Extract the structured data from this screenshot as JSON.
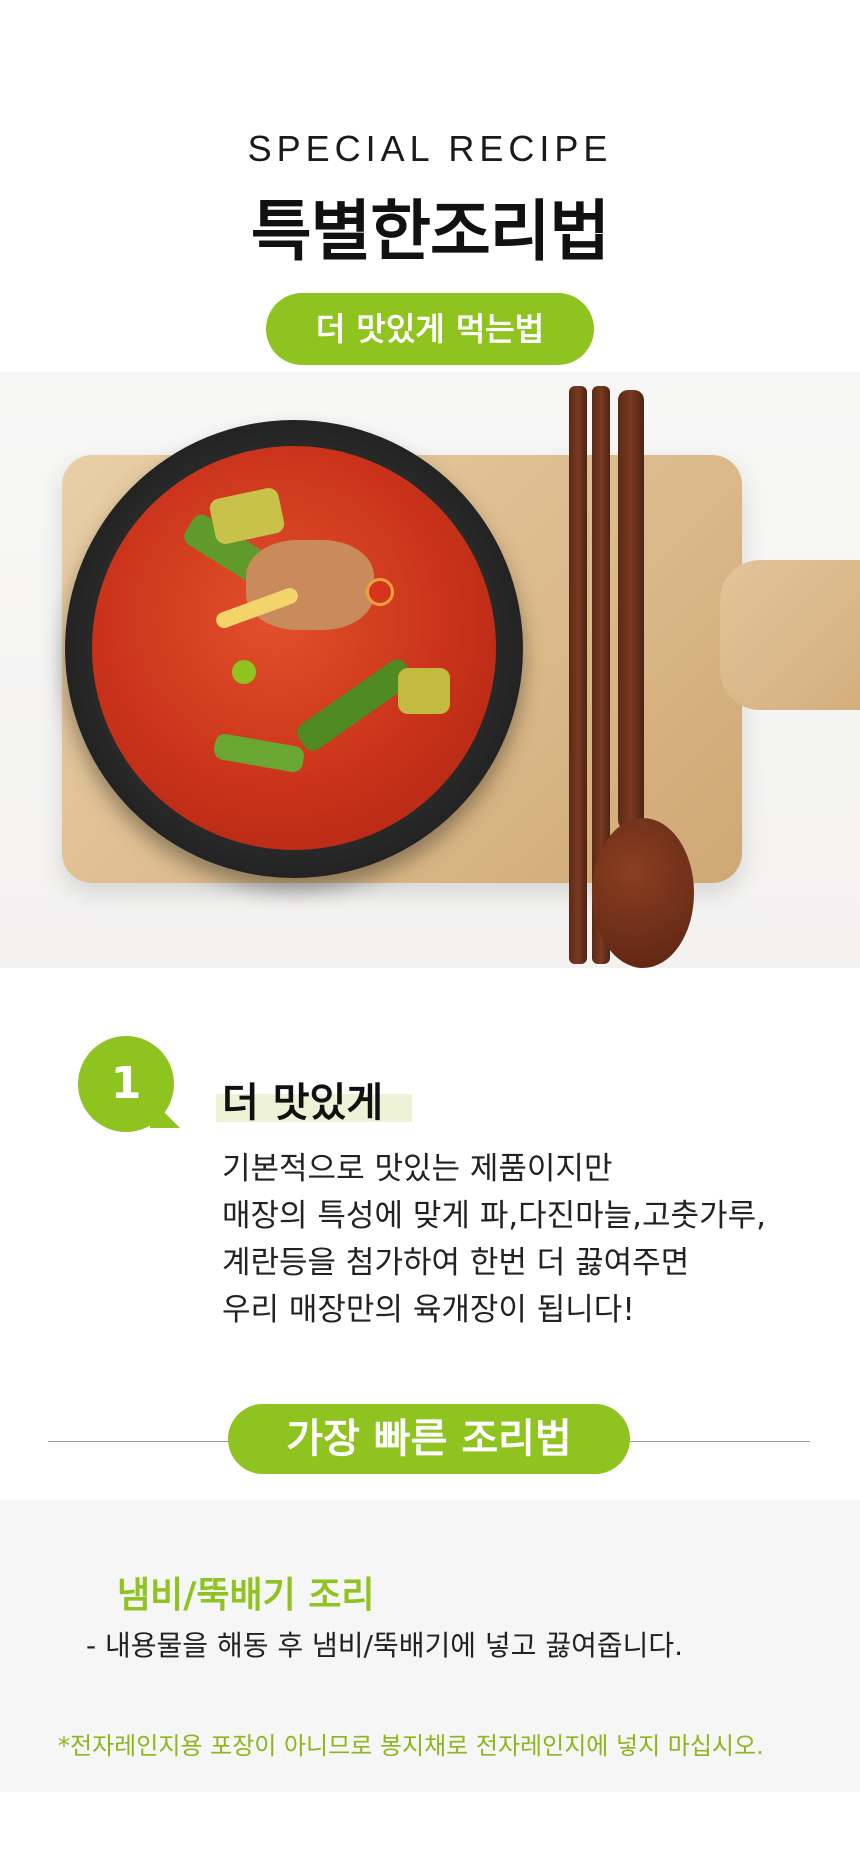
{
  "header": {
    "eyebrow": "SPECIAL RECIPE",
    "title": "특별한조리법",
    "badge": "더 맛있게 먹는법"
  },
  "section1": {
    "number": "1",
    "heading": "더 맛있게",
    "lines": [
      "기본적으로 맛있는 제품이지만",
      "매장의 특성에 맞게 파,다진마늘,고춧가루,",
      "계란등을 첨가하여 한번 더 끓여주면",
      "우리 매장만의 육개장이 됩니다!"
    ]
  },
  "section2": {
    "badge": "가장 빠른 조리법",
    "heading": "냄비/뚝배기 조리",
    "instruction": "- 내용물을 해동 후 냄비/뚝배기에 넣고 끓여줍니다.",
    "note": "*전자레인지용 포장이 아니므로 봉지채로 전자레인지에 넣지 마십시오."
  },
  "colors": {
    "accent": "#8fc31f",
    "note": "#8fb51c",
    "gray_box": "#f6f6f6"
  }
}
